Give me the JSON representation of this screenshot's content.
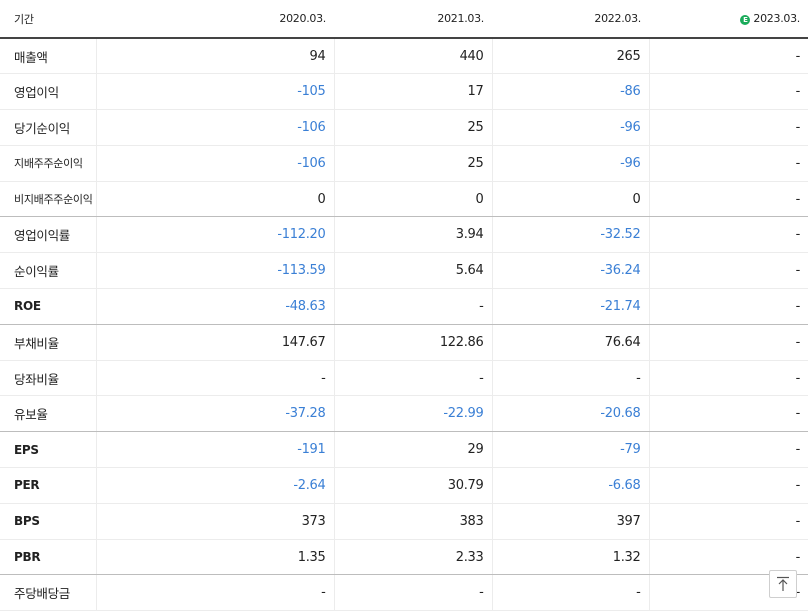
{
  "header": {
    "label": "기간",
    "columns": [
      "2020.03.",
      "2021.03.",
      "2022.03.",
      "2023.03."
    ],
    "estimate_badge": "E",
    "estimate_column": 3
  },
  "rows": [
    {
      "label": "매출액",
      "values": [
        "94",
        "440",
        "265",
        "-"
      ]
    },
    {
      "label": "영업이익",
      "values": [
        "-105",
        "17",
        "-86",
        "-"
      ]
    },
    {
      "label": "당기순이익",
      "values": [
        "-106",
        "25",
        "-96",
        "-"
      ]
    },
    {
      "label": "지배주주순이익",
      "values": [
        "-106",
        "25",
        "-96",
        "-"
      ]
    },
    {
      "label": "비지배주주순이익",
      "values": [
        "0",
        "0",
        "0",
        "-"
      ]
    },
    {
      "label": "영업이익률",
      "values": [
        "-112.20",
        "3.94",
        "-32.52",
        "-"
      ]
    },
    {
      "label": "순이익률",
      "values": [
        "-113.59",
        "5.64",
        "-36.24",
        "-"
      ]
    },
    {
      "label": "ROE",
      "values": [
        "-48.63",
        "-",
        "-21.74",
        "-"
      ]
    },
    {
      "label": "부채비율",
      "values": [
        "147.67",
        "122.86",
        "76.64",
        "-"
      ]
    },
    {
      "label": "당좌비율",
      "values": [
        "-",
        "-",
        "-",
        "-"
      ]
    },
    {
      "label": "유보율",
      "values": [
        "-37.28",
        "-22.99",
        "-20.68",
        "-"
      ]
    },
    {
      "label": "EPS",
      "values": [
        "-191",
        "29",
        "-79",
        "-"
      ]
    },
    {
      "label": "PER",
      "values": [
        "-2.64",
        "30.79",
        "-6.68",
        "-"
      ]
    },
    {
      "label": "BPS",
      "values": [
        "373",
        "383",
        "397",
        "-"
      ]
    },
    {
      "label": "PBR",
      "values": [
        "1.35",
        "2.33",
        "1.32",
        "-"
      ]
    },
    {
      "label": "주당배당금",
      "values": [
        "-",
        "-",
        "-",
        "-"
      ]
    }
  ],
  "colors": {
    "negative": "#3a7fd5",
    "estimate_badge": "#1aab5a"
  },
  "icons": {
    "scroll_top": "arrow-up-to-top-icon"
  }
}
